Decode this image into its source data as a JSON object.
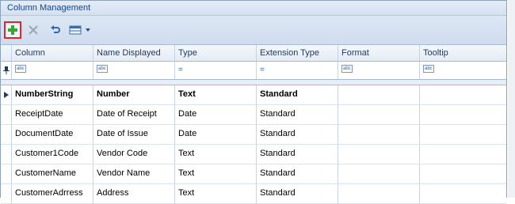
{
  "panel": {
    "title": "Column Management"
  },
  "toolbar": {
    "add_icon": "plus-icon",
    "delete_icon": "close-icon",
    "undo_icon": "undo-icon",
    "view_icon": "grid-view-icon"
  },
  "columns": [
    "Column",
    "Name Displayed",
    "Type",
    "Extension Type",
    "Format",
    "Tooltip"
  ],
  "filters": [
    "abc",
    "abc",
    "=",
    "=",
    "abc",
    "abc"
  ],
  "rows": [
    {
      "column": "NumberString",
      "name": "Number",
      "type": "Text",
      "ext": "Standard",
      "format": "",
      "tooltip": ""
    },
    {
      "column": "ReceiptDate",
      "name": "Date of Receipt",
      "type": "Date",
      "ext": "Standard",
      "format": "",
      "tooltip": ""
    },
    {
      "column": "DocumentDate",
      "name": "Date of Issue",
      "type": "Date",
      "ext": "Standard",
      "format": "",
      "tooltip": ""
    },
    {
      "column": "Customer1Code",
      "name": "Vendor Code",
      "type": "Text",
      "ext": "Standard",
      "format": "",
      "tooltip": ""
    },
    {
      "column": "CustomerName",
      "name": "Vendor Name",
      "type": "Text",
      "ext": "Standard",
      "format": "",
      "tooltip": ""
    },
    {
      "column": "CustomerAdrress",
      "name": "Address",
      "type": "Text",
      "ext": "Standard",
      "format": "",
      "tooltip": ""
    }
  ]
}
